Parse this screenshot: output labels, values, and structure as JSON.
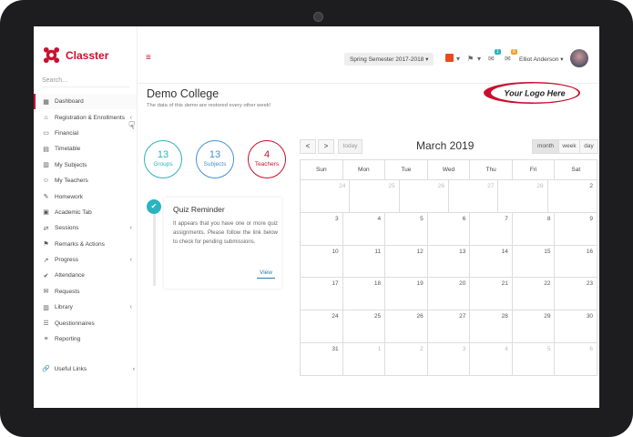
{
  "brand": {
    "name": "Classter",
    "accent": "#c8102e"
  },
  "sidebar": {
    "search_placeholder": "Search...",
    "items": [
      {
        "label": "Dashboard",
        "icon": "dashboard-icon",
        "active": true
      },
      {
        "label": "Registration & Enrollments",
        "icon": "bank-icon",
        "chevron": true
      },
      {
        "label": "Financial",
        "icon": "money-icon"
      },
      {
        "label": "Timetable",
        "icon": "calendar-icon"
      },
      {
        "label": "My Subjects",
        "icon": "book-icon"
      },
      {
        "label": "My Teachers",
        "icon": "person-icon"
      },
      {
        "label": "Homework",
        "icon": "homework-icon"
      },
      {
        "label": "Academic Tab",
        "icon": "tab-icon"
      },
      {
        "label": "Sessions",
        "icon": "sessions-icon",
        "chevron": true
      },
      {
        "label": "Remarks & Actions",
        "icon": "remarks-icon"
      },
      {
        "label": "Progress",
        "icon": "progress-icon",
        "chevron": true
      },
      {
        "label": "Attendance",
        "icon": "attendance-icon"
      },
      {
        "label": "Requests",
        "icon": "requests-icon"
      },
      {
        "label": "Library",
        "icon": "library-icon",
        "chevron": true
      },
      {
        "label": "Questionnaires",
        "icon": "questionnaire-icon"
      },
      {
        "label": "Reporting",
        "icon": "reporting-icon"
      }
    ],
    "useful_links": "Useful Links"
  },
  "topbar": {
    "semester": "Spring Semester 2017-2018",
    "badge_messages": "1",
    "badge_notifications": "8",
    "user_name": "Elliot Anderson"
  },
  "header": {
    "title": "Demo College",
    "subtitle": "The data of this demo are restored every other week!",
    "logo_text": "Your Logo Here"
  },
  "stats": [
    {
      "value": "13",
      "label": "Groups",
      "color": "#2ab3c0"
    },
    {
      "value": "13",
      "label": "Subjects",
      "color": "#4a8fd0"
    },
    {
      "value": "4",
      "label": "Teachers",
      "color": "#c8102e"
    }
  ],
  "quiz": {
    "title": "Quiz Reminder",
    "text": "It appears that you have one or more quiz assignments. Please follow the link below to check for pending submissions.",
    "link": "View"
  },
  "calendar": {
    "prev": "<",
    "next": ">",
    "today_label": "today",
    "title": "March 2019",
    "views": [
      "month",
      "week",
      "day"
    ],
    "weekdays": [
      "Sun",
      "Mon",
      "Tue",
      "Wed",
      "Thu",
      "Fri",
      "Sat"
    ],
    "weeks": [
      [
        "24",
        "25",
        "26",
        "27",
        "28",
        "1",
        "2"
      ],
      [
        "3",
        "4",
        "5",
        "6",
        "7",
        "8",
        "9"
      ],
      [
        "10",
        "11",
        "12",
        "13",
        "14",
        "15",
        "16"
      ],
      [
        "17",
        "18",
        "19",
        "20",
        "21",
        "22",
        "23"
      ],
      [
        "24",
        "25",
        "26",
        "27",
        "28",
        "29",
        "30"
      ],
      [
        "31",
        "1",
        "2",
        "3",
        "4",
        "5",
        "6"
      ]
    ]
  }
}
